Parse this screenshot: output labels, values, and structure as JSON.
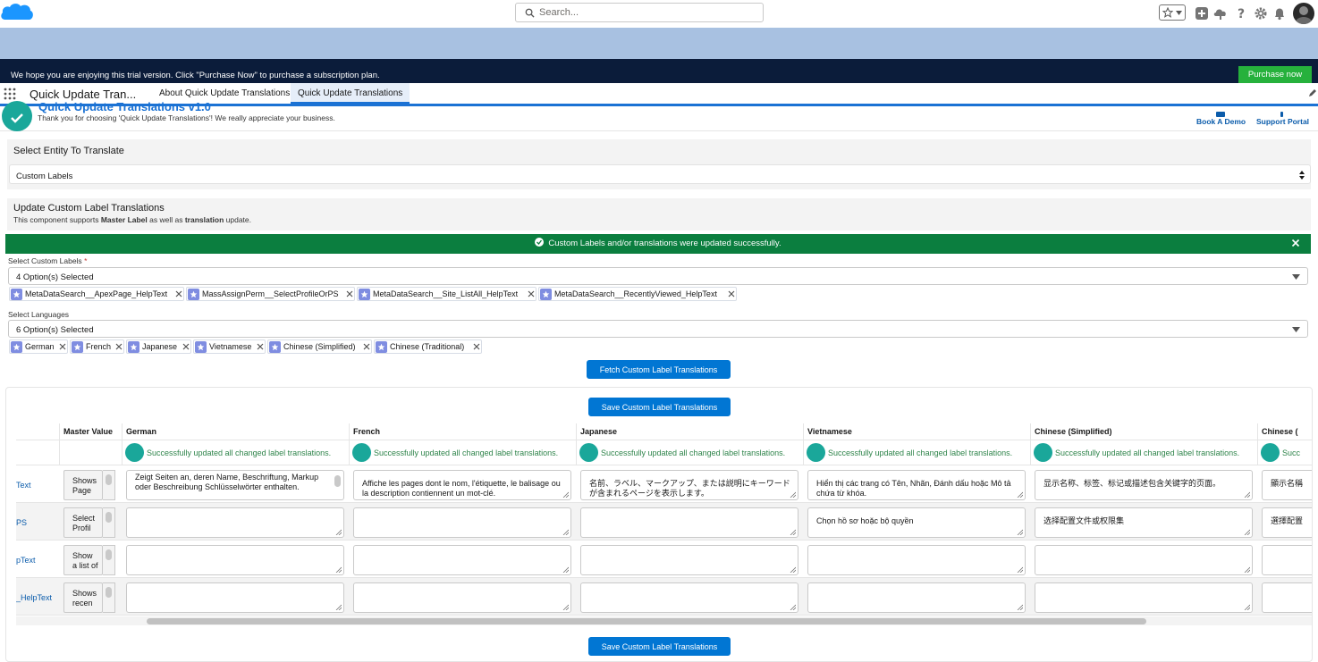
{
  "global_header": {
    "search_placeholder": "Search..."
  },
  "trial_banner": {
    "text": "We hope you are enjoying this trial version. Click \"Purchase Now\" to purchase a subscription plan.",
    "button": "Purchase now"
  },
  "app_nav": {
    "app_name": "Quick Update Tran...",
    "tabs": [
      {
        "label": "About Quick Update Translations"
      },
      {
        "label": "Quick Update Translations"
      }
    ]
  },
  "page_header": {
    "title": "Quick Update Translations v1.0",
    "subtitle": "Thank you for choosing 'Quick Update Translations'! We really appreciate your business.",
    "links": [
      "Book A Demo",
      "Support Portal"
    ]
  },
  "entity_section": {
    "title": "Select Entity To Translate",
    "selected": "Custom Labels"
  },
  "update_section": {
    "title": "Update Custom Label Translations",
    "desc_prefix": "This component supports ",
    "desc_bold1": "Master Label",
    "desc_mid": " as well as ",
    "desc_bold2": "translation",
    "desc_suffix": " update."
  },
  "success_banner": {
    "text": "Custom Labels and/or translations were updated successfully."
  },
  "custom_labels": {
    "label": "Select Custom Labels",
    "required_mark": "*",
    "summary": "4 Option(s) Selected",
    "pills": [
      "MetaDataSearch__ApexPage_HelpText",
      "MassAssignPerm__SelectProfileOrPS",
      "MetaDataSearch__Site_ListAll_HelpText",
      "MetaDataSearch__RecentlyViewed_HelpText"
    ]
  },
  "languages": {
    "label": "Select Languages",
    "summary": "6 Option(s) Selected",
    "pills": [
      "German",
      "French",
      "Japanese",
      "Vietnamese",
      "Chinese (Simplified)",
      "Chinese (Traditional)"
    ]
  },
  "buttons": {
    "fetch": "Fetch Custom Label Translations",
    "save_top": "Save Custom Label Translations",
    "save_bottom": "Save Custom Label Translations"
  },
  "grid": {
    "master_header": "Master Value",
    "lang_headers": [
      "German",
      "French",
      "Japanese",
      "Vietnamese",
      "Chinese (Simplified)",
      "Chinese ("
    ],
    "status_text": "Successfully updated all changed label translations.",
    "status_text_clipped": "Succ",
    "rows": [
      {
        "key": "Text",
        "master": "Shows Page",
        "cells": [
          "Zeigt Seiten an, deren Name, Beschriftung, Markup oder Beschreibung Schlüsselwörter enthalten.",
          "Affiche les pages dont le nom, l'étiquette, le balisage ou la description contiennent un mot-clé.",
          "名前、ラベル、マークアップ、または説明にキーワードが含まれるページを表示します。",
          "Hiển thị các trang có Tên, Nhãn, Đánh dấu hoặc Mô tả chứa từ khóa.",
          "显示名称、标签、标记或描述包含关键字的页面。",
          "顯示名稱"
        ]
      },
      {
        "key": "PS",
        "master": "Select Profil",
        "cells": [
          "",
          "",
          "",
          "Chọn hồ sơ hoặc bộ quyền",
          "选择配置文件或权限集",
          "選擇配置"
        ]
      },
      {
        "key": "pText",
        "master": "Show a list of",
        "cells": [
          "",
          "",
          "",
          "",
          "",
          ""
        ]
      },
      {
        "key": "_HelpText",
        "master": "Shows recen",
        "cells": [
          "",
          "",
          "",
          "",
          "",
          ""
        ]
      }
    ]
  }
}
